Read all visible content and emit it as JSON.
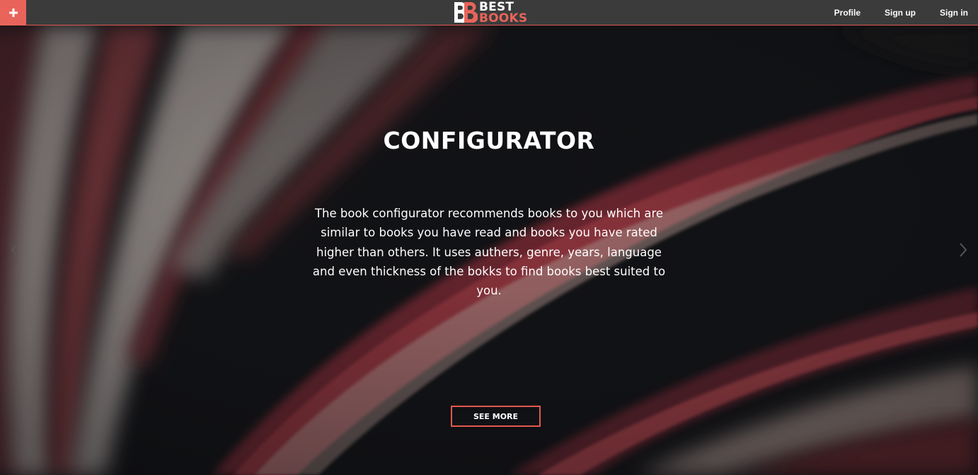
{
  "navbar": {
    "plus_icon": "plus-icon",
    "logo": {
      "line1": "BEST",
      "line2": "BOOKS"
    },
    "links": [
      {
        "label": "Profile"
      },
      {
        "label": "Sign up"
      },
      {
        "label": "Sign in"
      }
    ]
  },
  "hero": {
    "title": "CONFIGURATOR",
    "description": "The book configurator recommends books to you which are similar to books you have read and books you have rated higher than others. It uses authers, genre, years, language and even thickness of the bokks to find books best suited to you.",
    "button_label": "SEE MORE",
    "prev_icon": "chevron-left-icon",
    "next_icon": "chevron-right-icon"
  },
  "colors": {
    "accent": "#e8645a",
    "navbar_bg": "#3b3b3c",
    "hero_bg": "#141518"
  }
}
